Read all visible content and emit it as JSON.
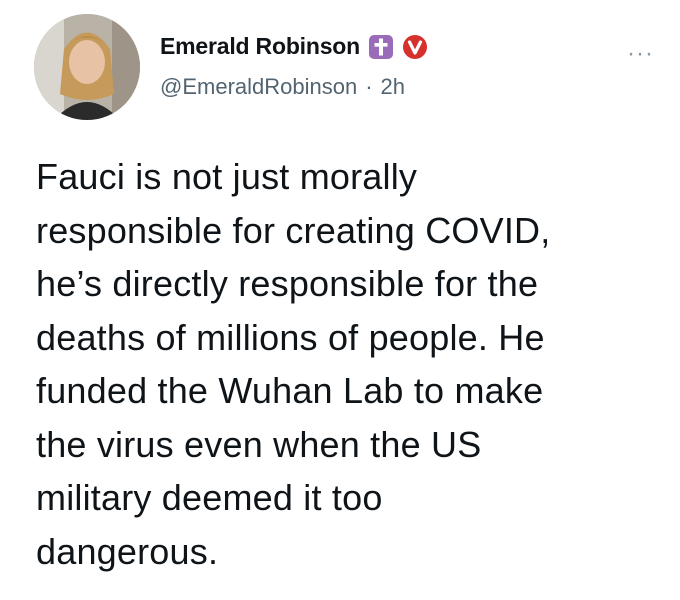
{
  "tweet": {
    "author": {
      "display_name": "Emerald Robinson",
      "handle": "@EmeraldRobinson",
      "badges": [
        "cross-badge-icon",
        "verified-badge-icon"
      ]
    },
    "time": "2h",
    "separator": "·",
    "more_label": "···",
    "text": "Fauci is not just morally\nresponsible for creating COVID,\nhe’s directly responsible for the\ndeaths of millions of people. He\nfunded the Wuhan Lab to make\nthe virus even when the US\nmilitary deemed it too\ndangerous."
  },
  "colors": {
    "text_primary": "#0f1419",
    "text_secondary": "#536471",
    "cross_badge": "#9a6bb8",
    "verified_badge": "#d5322d"
  }
}
